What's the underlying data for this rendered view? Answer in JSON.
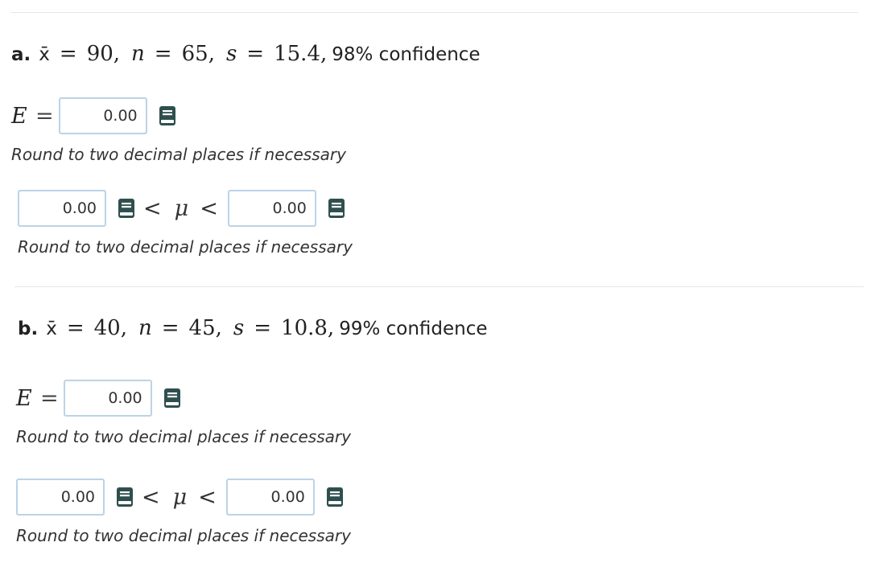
{
  "placeholders": {
    "answer": "0.00"
  },
  "hint": "Round to two decimal places if necessary",
  "symbols": {
    "xbar": "x̄",
    "n": "n",
    "s": "s",
    "E": "E",
    "mu": "μ",
    "eq": "=",
    "lt": "<"
  },
  "parts": [
    {
      "letter": "a.",
      "xbar": "90",
      "n": "65",
      "s": "15.4",
      "confidence": "98% confidence",
      "E_value": "0.00",
      "lower_value": "0.00",
      "upper_value": "0.00"
    },
    {
      "letter": "b.",
      "xbar": "40",
      "n": "45",
      "s": "10.8",
      "confidence": "99% confidence",
      "E_value": "0.00",
      "lower_value": "0.00",
      "upper_value": "0.00"
    }
  ],
  "colors": {
    "icon": "#2f4f4f",
    "input_border": "#bcd3e6",
    "divider": "#e6e6e6"
  },
  "icons": {
    "calculator": "book-icon"
  }
}
